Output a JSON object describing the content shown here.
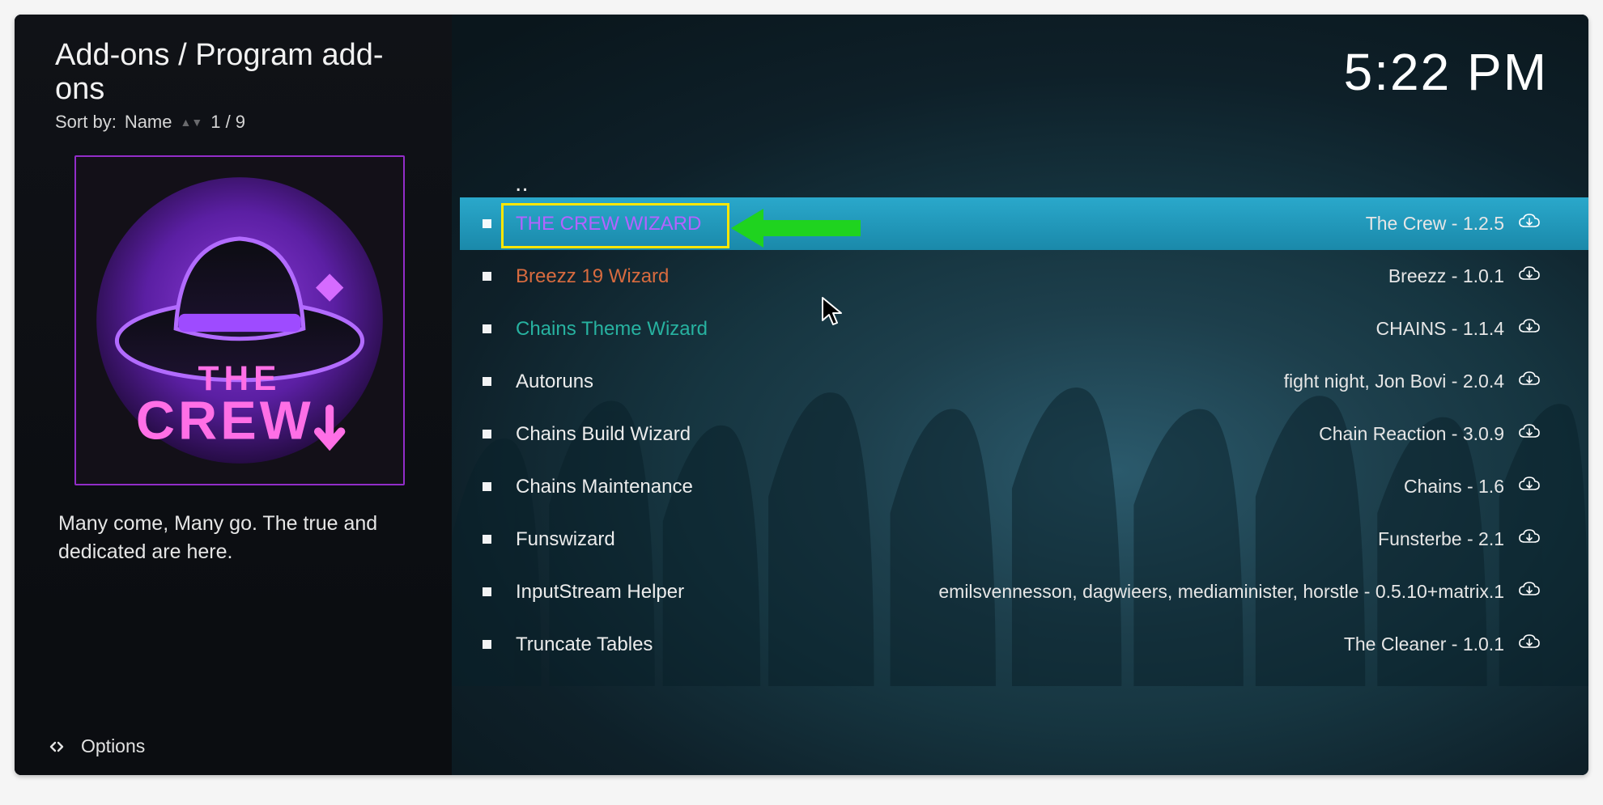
{
  "header": {
    "breadcrumb": "Add-ons / Program add-ons",
    "sort_label": "Sort by:",
    "sort_value": "Name",
    "position": "1 / 9"
  },
  "clock": "5:22 PM",
  "sidebar": {
    "description": "Many come, Many go. The true and dedicated are here.",
    "thumbnail_label": "the-crew-logo"
  },
  "options": {
    "label": "Options"
  },
  "parent_dots": "..",
  "addons": [
    {
      "name": "THE CREW WIZARD",
      "meta": "The Crew - 1.2.5",
      "selected": true
    },
    {
      "name": "Breezz 19 Wizard",
      "meta": "Breezz - 1.0.1",
      "selected": false
    },
    {
      "name": "Chains Theme Wizard",
      "meta": "CHAINS - 1.1.4",
      "selected": false
    },
    {
      "name": "Autoruns",
      "meta": "fight night, Jon Bovi - 2.0.4",
      "selected": false
    },
    {
      "name": "Chains Build Wizard",
      "meta": "Chain Reaction - 3.0.9",
      "selected": false
    },
    {
      "name": "Chains Maintenance",
      "meta": "Chains - 1.6",
      "selected": false
    },
    {
      "name": "Funswizard",
      "meta": "Funsterbe - 2.1",
      "selected": false
    },
    {
      "name": "InputStream Helper",
      "meta": "emilsvennesson, dagwieers, mediaminister, horstle - 0.5.10+matrix.1",
      "selected": false
    },
    {
      "name": "Truncate Tables",
      "meta": "The Cleaner - 1.0.1",
      "selected": false
    }
  ],
  "colors": {
    "accent_purple": "#922dc8",
    "highlight_yellow": "#ffe600",
    "arrow_green": "#22d122",
    "selection_blue": "#1f97bd"
  }
}
